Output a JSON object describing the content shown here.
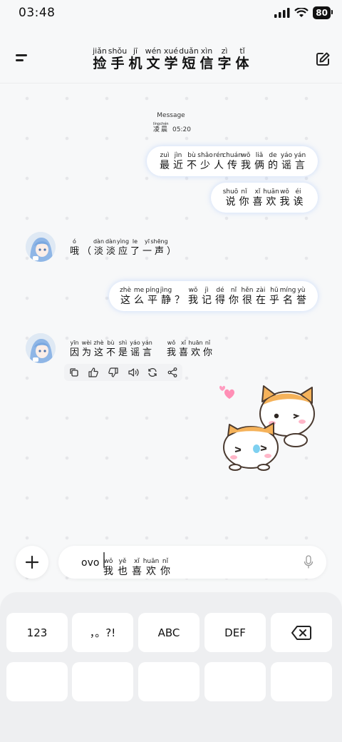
{
  "status_bar": {
    "time": "03:48",
    "battery": "80"
  },
  "header": {
    "title": [
      {
        "py": "jiǎn",
        "hz": "捡"
      },
      {
        "py": "shǒu",
        "hz": "手"
      },
      {
        "py": "jī",
        "hz": "机"
      },
      {
        "py": "wén",
        "hz": "文"
      },
      {
        "py": "xué",
        "hz": "学"
      },
      {
        "py": "duǎn",
        "hz": "短"
      },
      {
        "py": "xìn",
        "hz": "信"
      },
      {
        "py": "zì",
        "hz": "字"
      },
      {
        "py": "tǐ",
        "hz": "体"
      }
    ]
  },
  "chat": {
    "message_label": "Message",
    "timestamp": {
      "chars": [
        {
          "py": "líng",
          "hz": "凌"
        },
        {
          "py": "chén",
          "hz": "晨"
        }
      ],
      "time": "05:20"
    },
    "user_messages": [
      [
        {
          "py": "zuì",
          "hz": "最"
        },
        {
          "py": "jìn",
          "hz": "近"
        },
        {
          "py": "bù",
          "hz": "不"
        },
        {
          "py": "shǎo",
          "hz": "少"
        },
        {
          "py": "rén",
          "hz": "人"
        },
        {
          "py": "chuán",
          "hz": "传"
        },
        {
          "py": "wǒ",
          "hz": "我"
        },
        {
          "py": "liǎ",
          "hz": "俩"
        },
        {
          "py": "de",
          "hz": "的"
        },
        {
          "py": "yáo",
          "hz": "谣"
        },
        {
          "py": "yán",
          "hz": "言"
        }
      ],
      [
        {
          "py": "shuō",
          "hz": "说"
        },
        {
          "py": "nǐ",
          "hz": "你"
        },
        {
          "py": "xǐ",
          "hz": "喜"
        },
        {
          "py": "huān",
          "hz": "欢"
        },
        {
          "py": "wǒ",
          "hz": "我"
        },
        {
          "py": "éi",
          "hz": "诶"
        }
      ],
      [
        {
          "py": "zhè",
          "hz": "这"
        },
        {
          "py": "me",
          "hz": "么"
        },
        {
          "py": "píng",
          "hz": "平"
        },
        {
          "py": "jìng",
          "hz": "静"
        },
        {
          "py": "",
          "hz": "？"
        },
        {
          "py": "wǒ",
          "hz": "我"
        },
        {
          "py": "jì",
          "hz": "记"
        },
        {
          "py": "dé",
          "hz": "得"
        },
        {
          "py": "nǐ",
          "hz": "你"
        },
        {
          "py": "hěn",
          "hz": "很"
        },
        {
          "py": "zài",
          "hz": "在"
        },
        {
          "py": "hū",
          "hz": "乎"
        },
        {
          "py": "míng",
          "hz": "名"
        },
        {
          "py": "yù",
          "hz": "誉"
        }
      ]
    ],
    "ai_messages": [
      [
        {
          "py": "ó",
          "hz": "哦"
        },
        {
          "py": "",
          "hz": "（"
        },
        {
          "py": "dàn",
          "hz": "淡"
        },
        {
          "py": "dàn",
          "hz": "淡"
        },
        {
          "py": "yìng",
          "hz": "应"
        },
        {
          "py": "le",
          "hz": "了"
        },
        {
          "py": "yī",
          "hz": "一"
        },
        {
          "py": "shēng",
          "hz": "声"
        },
        {
          "py": "",
          "hz": "）"
        }
      ],
      [
        {
          "py": "yīn",
          "hz": "因"
        },
        {
          "py": "wèi",
          "hz": "为"
        },
        {
          "py": "zhè",
          "hz": "这"
        },
        {
          "py": "bù",
          "hz": "不"
        },
        {
          "py": "shì",
          "hz": "是"
        },
        {
          "py": "yáo",
          "hz": "谣"
        },
        {
          "py": "yán",
          "hz": "言"
        },
        {
          "py": "",
          "hz": " "
        },
        {
          "py": "wǒ",
          "hz": "我"
        },
        {
          "py": "xǐ",
          "hz": "喜"
        },
        {
          "py": "huān",
          "hz": "欢"
        },
        {
          "py": "nǐ",
          "hz": "你"
        }
      ]
    ],
    "action_icons": [
      "copy-icon",
      "thumbs-up-icon",
      "thumbs-down-icon",
      "speaker-icon",
      "regenerate-icon",
      "share-icon"
    ]
  },
  "composer": {
    "chars": [
      {
        "py": "wǒ",
        "hz": "我"
      },
      {
        "py": "yě",
        "hz": "也"
      },
      {
        "py": "xǐ",
        "hz": "喜"
      },
      {
        "py": "huān",
        "hz": "欢"
      },
      {
        "py": "nǐ",
        "hz": "你"
      }
    ],
    "latin": "ovo"
  },
  "keyboard": {
    "row1": [
      "123",
      "，。?!",
      "ABC",
      "DEF"
    ],
    "row2": [
      "",
      "",
      "",
      "",
      ""
    ]
  }
}
